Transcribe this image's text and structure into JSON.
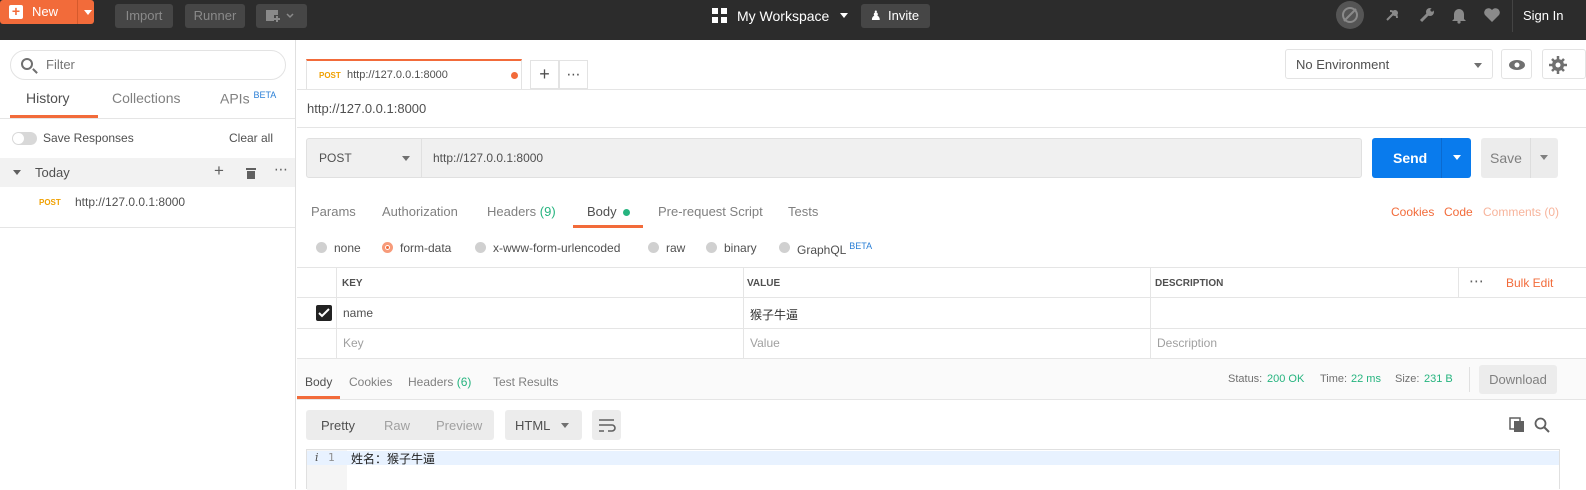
{
  "topbar": {
    "new_label": "New",
    "import_label": "Import",
    "runner_label": "Runner",
    "workspace_label": "My Workspace",
    "invite_label": "Invite",
    "signin_label": "Sign In"
  },
  "sidebar": {
    "filter_placeholder": "Filter",
    "tabs": {
      "history": "History",
      "collections": "Collections",
      "apis": "APIs",
      "apis_badge": "BETA"
    },
    "save_responses_label": "Save Responses",
    "clear_all_label": "Clear all",
    "group_label": "Today",
    "history_items": [
      {
        "method": "POST",
        "url": "http://127.0.0.1:8000"
      }
    ]
  },
  "request_tab": {
    "method": "POST",
    "url": "http://127.0.0.1:8000"
  },
  "environment": {
    "selected": "No Environment"
  },
  "request": {
    "title": "http://127.0.0.1:8000",
    "method": "POST",
    "url": "http://127.0.0.1:8000",
    "send_label": "Send",
    "save_label": "Save",
    "tabs": {
      "params": "Params",
      "authorization": "Authorization",
      "headers": "Headers",
      "headers_count": "(9)",
      "body": "Body",
      "prerequest": "Pre-request Script",
      "tests": "Tests"
    },
    "links": {
      "cookies": "Cookies",
      "code": "Code",
      "comments": "Comments (0)"
    },
    "body_types": {
      "none": "none",
      "form_data": "form-data",
      "urlencoded": "x-www-form-urlencoded",
      "raw": "raw",
      "binary": "binary",
      "graphql": "GraphQL",
      "graphql_badge": "BETA"
    },
    "table": {
      "headers": {
        "key": "KEY",
        "value": "VALUE",
        "description": "DESCRIPTION",
        "bulk_edit": "Bulk Edit"
      },
      "rows": [
        {
          "key": "name",
          "value": "猴子牛逼",
          "description": ""
        }
      ],
      "placeholders": {
        "key": "Key",
        "value": "Value",
        "description": "Description"
      }
    }
  },
  "response": {
    "tabs": {
      "body": "Body",
      "cookies": "Cookies",
      "headers": "Headers",
      "headers_count": "(6)",
      "test_results": "Test Results"
    },
    "status_label": "Status:",
    "status_value": "200 OK",
    "time_label": "Time:",
    "time_value": "22 ms",
    "size_label": "Size:",
    "size_value": "231 B",
    "download_label": "Download",
    "view_modes": {
      "pretty": "Pretty",
      "raw": "Raw",
      "preview": "Preview"
    },
    "format": "HTML",
    "line_number": "1",
    "line_info": "i",
    "content": "姓名：猴子牛逼"
  },
  "colors": {
    "accent": "#f26b3a",
    "send_blue": "#097bed",
    "success_green": "#26b47f",
    "topbar": "#2c2c2c"
  }
}
